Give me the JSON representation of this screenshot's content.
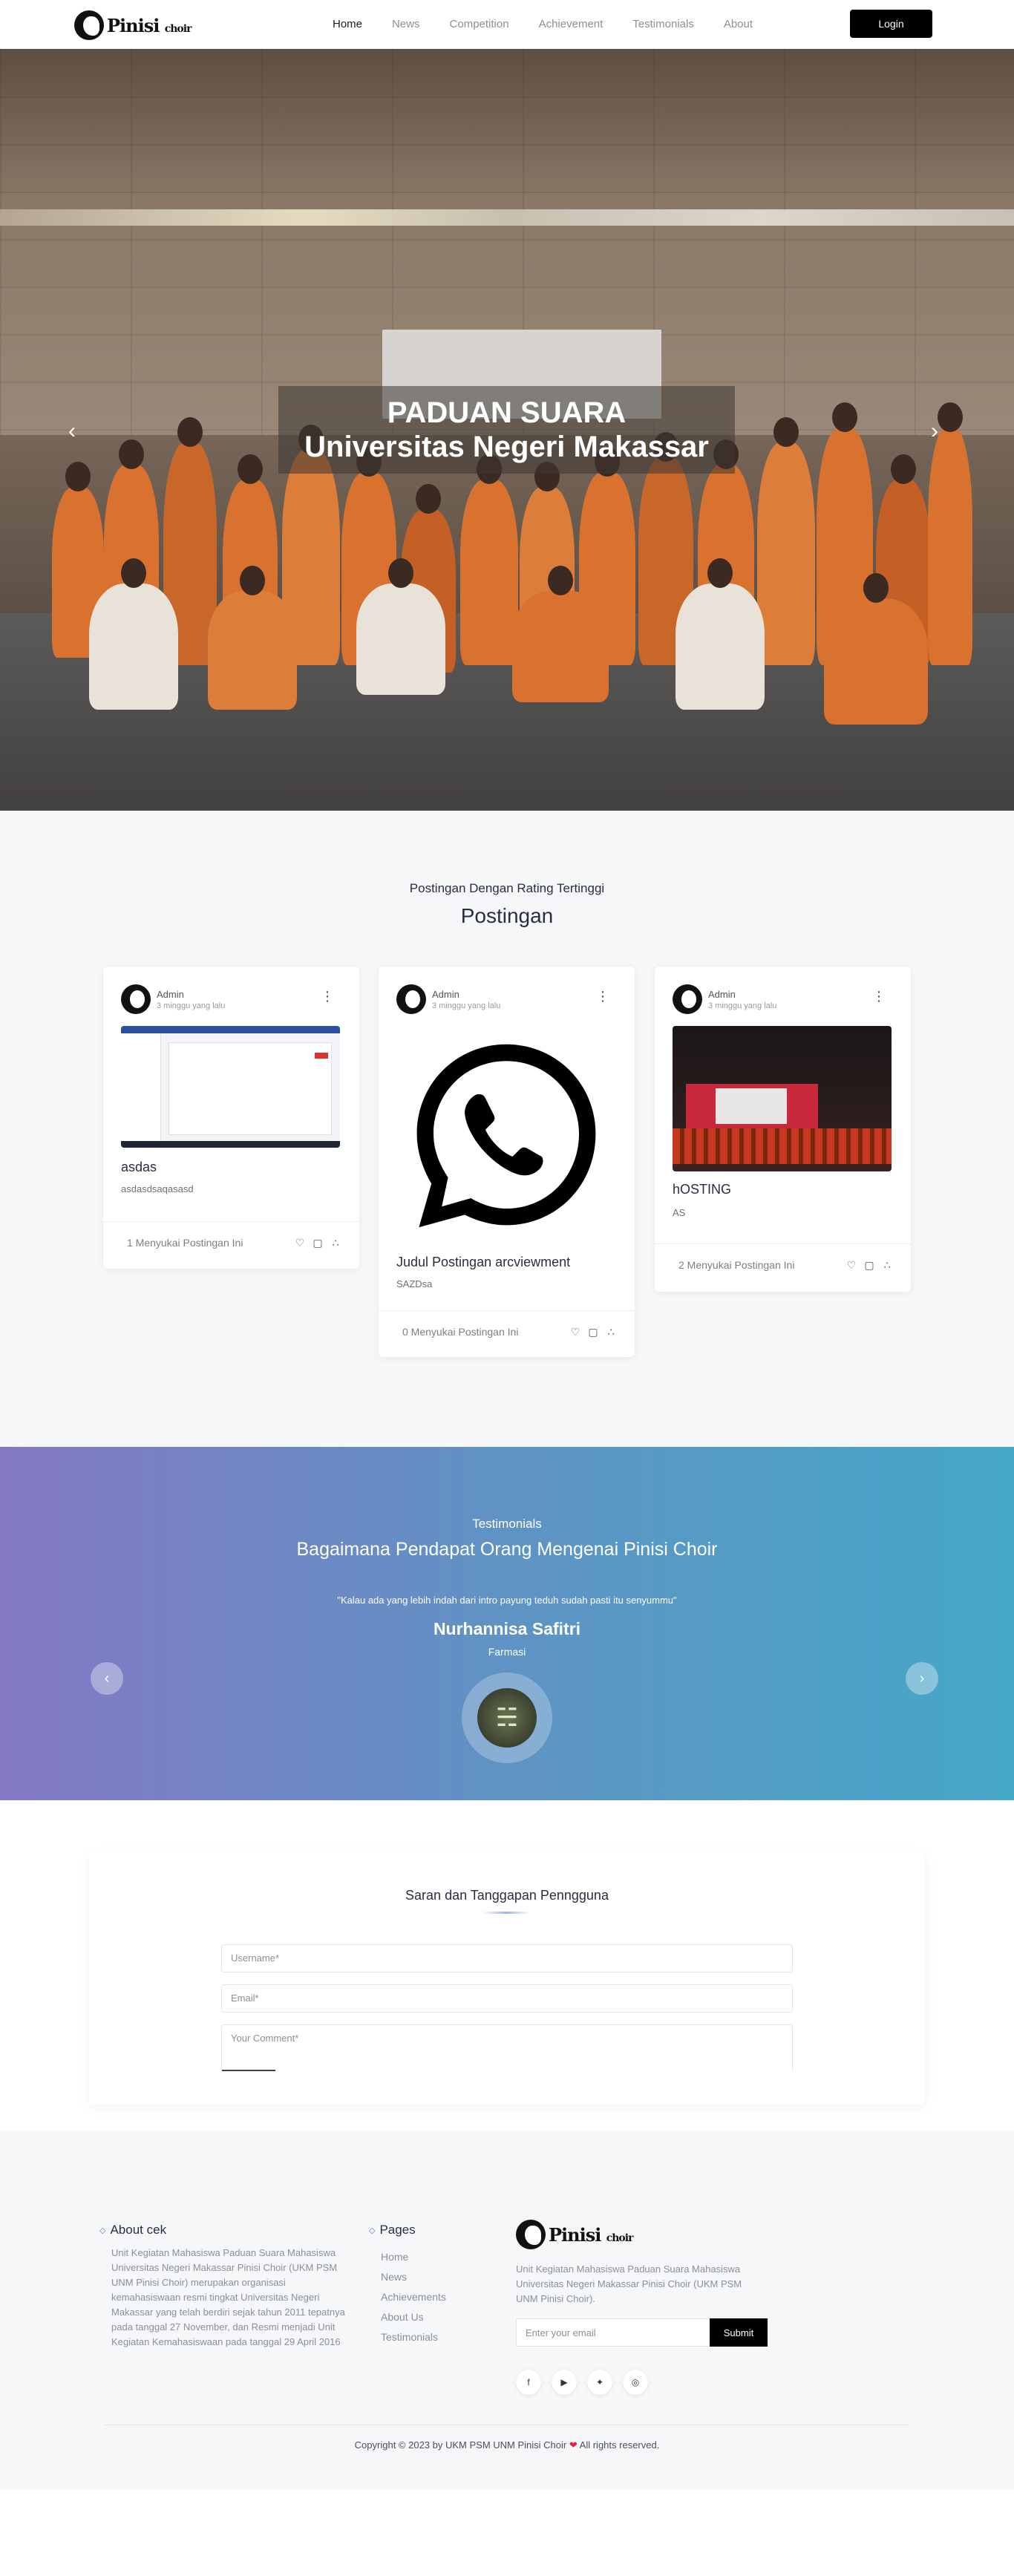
{
  "brand": {
    "name": "Pinisi Choir",
    "logo_text_main": "Pinisi",
    "logo_text_small": "choir"
  },
  "nav": {
    "items": [
      {
        "label": "Home",
        "active": true
      },
      {
        "label": "News",
        "active": false
      },
      {
        "label": "Competition",
        "active": false
      },
      {
        "label": "Achievement",
        "active": false
      },
      {
        "label": "Testimonials",
        "active": false
      },
      {
        "label": "About",
        "active": false
      }
    ],
    "login_label": "Login"
  },
  "hero": {
    "line1": "PADUAN SUARA",
    "line2": "Universitas Negeri Makassar",
    "prev_icon": "chevron-left-icon",
    "next_icon": "chevron-right-icon"
  },
  "posts": {
    "subtitle": "Postingan Dengan Rating Tertinggi",
    "title": "Postingan",
    "cards": [
      {
        "author": "Admin",
        "time": "3 minggu yang lalu",
        "title": "asdas",
        "body": "asdasdsaqasasd",
        "likes": "1 Menyukai Postingan Ini",
        "image": "screenshot"
      },
      {
        "author": "Admin",
        "time": "3 minggu yang lalu",
        "title": "Judul Postingan arcviewment",
        "body": "SAZDsa",
        "likes": "0 Menyukai Postingan Ini",
        "image": "whatsapp-logo"
      },
      {
        "author": "Admin",
        "time": "3 minggu yang lalu",
        "title": "hOSTING",
        "body": "AS",
        "likes": "2 Menyukai Postingan Ini",
        "image": "concert-photo"
      }
    ]
  },
  "testimonials": {
    "subtitle": "Testimonials",
    "title": "Bagaimana Pendapat Orang Mengenai Pinisi Choir",
    "quote": "\"Kalau ada yang lebih indah dari intro payung teduh sudah pasti itu senyummu\"",
    "name": "Nurhannisa Safitri",
    "role": "Farmasi"
  },
  "feedback": {
    "title": "Saran dan Tanggapan Penngguna",
    "username_placeholder": "Username*",
    "email_placeholder": "Email*",
    "comment_placeholder": "Your Comment*"
  },
  "footer": {
    "about_title": "About cek",
    "about_text": "Unit Kegiatan Mahasiswa Paduan Suara Mahasiswa Universitas Negeri Makassar Pinisi Choir (UKM PSM UNM Pinisi Choir) merupakan organisasi kemahasiswaan resmi tingkat Universitas Negeri Makassar yang telah berdiri sejak tahun 2011 tepatnya pada tanggal 27 November, dan Resmi menjadi Unit Kegiatan Kemahasiswaan pada tanggal 29 April 2016",
    "pages_title": "Pages",
    "pages": [
      "Home",
      "News",
      "Achievements",
      "About Us",
      "Testimonials"
    ],
    "brand_desc": "Unit Kegiatan Mahasiswa Paduan Suara Mahasiswa Universitas Negeri Makassar Pinisi Choir (UKM PSM UNM Pinisi Choir).",
    "email_placeholder": "Enter your email",
    "submit_label": "Submit",
    "socials": [
      {
        "name": "facebook-icon",
        "glyph": "f"
      },
      {
        "name": "youtube-icon",
        "glyph": "▶"
      },
      {
        "name": "twitter-icon",
        "glyph": "🐦"
      },
      {
        "name": "instagram-icon",
        "glyph": "◎"
      }
    ],
    "copyright_before": "Copyright © 2023 by UKM PSM UNM Pinisi Choir",
    "copyright_after": "All rights reserved."
  },
  "colors": {
    "accent": "#000000",
    "testimonial_gradient_start": "#8478c4",
    "testimonial_gradient_end": "#45a8c9",
    "heart": "#e0263c"
  }
}
